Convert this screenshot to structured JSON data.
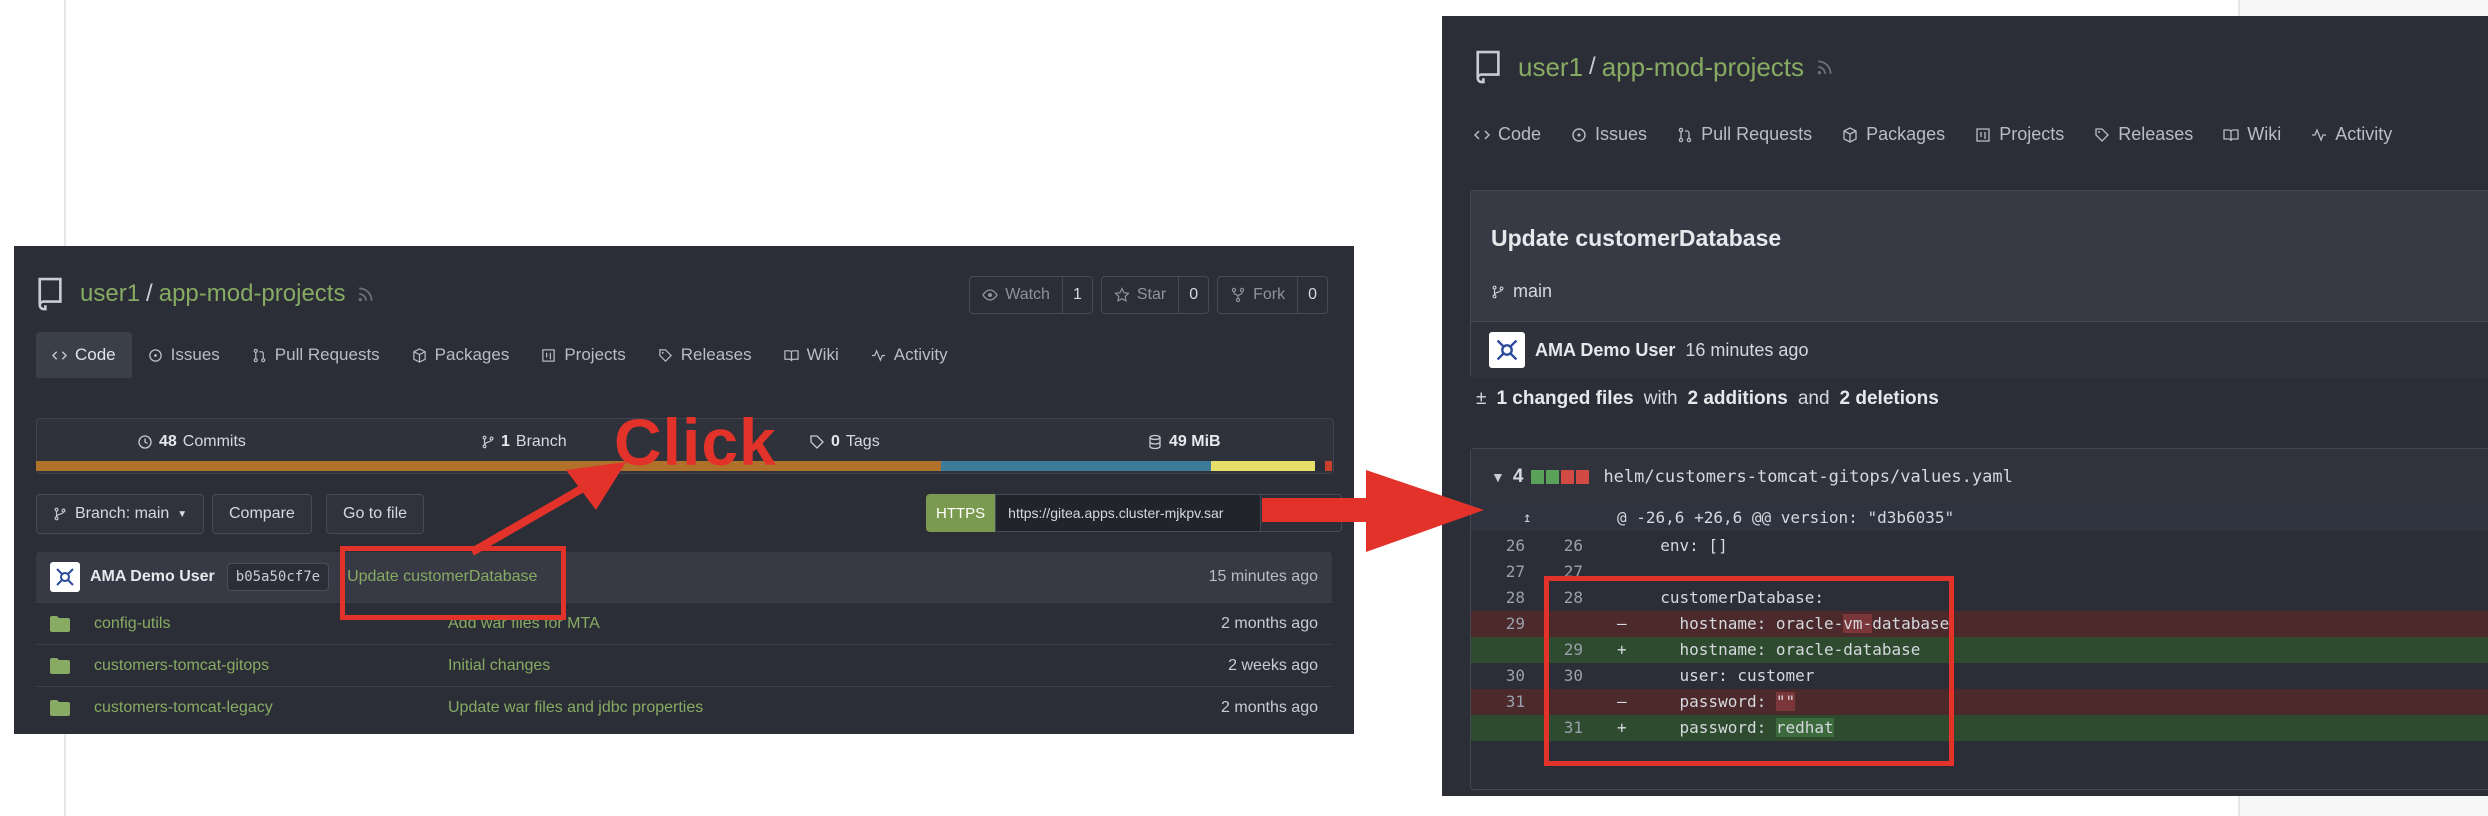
{
  "left": {
    "repo": {
      "owner": "user1",
      "sep": "/",
      "name": "app-mod-projects"
    },
    "actions": [
      {
        "label": "Watch",
        "count": "1",
        "icon": "eye-icon"
      },
      {
        "label": "Star",
        "count": "0",
        "icon": "star-icon"
      },
      {
        "label": "Fork",
        "count": "0",
        "icon": "fork-icon"
      }
    ],
    "tabs": [
      "Code",
      "Issues",
      "Pull Requests",
      "Packages",
      "Projects",
      "Releases",
      "Wiki",
      "Activity"
    ],
    "stats": {
      "commits_num": "48",
      "commits_label": "Commits",
      "branch_num": "1",
      "branch_label": "Branch",
      "tags_num": "0",
      "tags_label": "Tags",
      "size": "49 MiB"
    },
    "lang_colors": [
      "#b0722a",
      "#3d7b9a",
      "#e8de6a",
      "#c8402a"
    ],
    "branch_btn": "Branch: main",
    "compare": "Compare",
    "goto_file": "Go to file",
    "clone_protocol": "HTTPS",
    "clone_url": "https://gitea.apps.cluster-mjkpv.sar",
    "last_commit": {
      "author": "AMA Demo User",
      "sha": "b05a50cf7e",
      "message": "Update customerDatabase",
      "time": "15 minutes ago"
    },
    "files": [
      {
        "name": "config-utils",
        "message": "Add war files for MTA",
        "time": "2 months ago"
      },
      {
        "name": "customers-tomcat-gitops",
        "message": "Initial changes",
        "time": "2 weeks ago"
      },
      {
        "name": "customers-tomcat-legacy",
        "message": "Update war files and jdbc properties",
        "time": "2 months ago"
      }
    ]
  },
  "right": {
    "repo": {
      "owner": "user1",
      "sep": "/",
      "name": "app-mod-projects"
    },
    "tabs": [
      "Code",
      "Issues",
      "Pull Requests",
      "Packages",
      "Projects",
      "Releases",
      "Wiki",
      "Activity"
    ],
    "commit_title": "Update customerDatabase",
    "branch": "main",
    "author": "AMA Demo User",
    "time": "16 minutes ago",
    "summary": {
      "sign": "±",
      "files": "1 changed files",
      "with": "with",
      "additions": "2 additions",
      "and": "and",
      "deletions": "2 deletions"
    },
    "diff": {
      "count": "4",
      "file": "helm/customers-tomcat-gitops/values.yaml",
      "hunk": "@ -26,6 +26,6 @@ version: \"d3b6035\""
    },
    "lines": [
      {
        "old": "26",
        "new": "26",
        "sign": "",
        "pre": "  env: []",
        "hl": "",
        "post": "",
        "type": "ctx"
      },
      {
        "old": "27",
        "new": "27",
        "sign": "",
        "pre": "",
        "hl": "",
        "post": "",
        "type": "ctx"
      },
      {
        "old": "28",
        "new": "28",
        "sign": "",
        "pre": "  customerDatabase:",
        "hl": "",
        "post": "",
        "type": "ctx"
      },
      {
        "old": "29",
        "new": "",
        "sign": "–",
        "pre": "    hostname: oracle-",
        "hl": "vm-",
        "post": "database",
        "type": "del"
      },
      {
        "old": "",
        "new": "29",
        "sign": "+",
        "pre": "    hostname: oracle-database",
        "hl": "",
        "post": "",
        "type": "add"
      },
      {
        "old": "30",
        "new": "30",
        "sign": "",
        "pre": "    user: customer",
        "hl": "",
        "post": "",
        "type": "ctx"
      },
      {
        "old": "31",
        "new": "",
        "sign": "–",
        "pre": "    password: ",
        "hl": "\"\"",
        "post": "",
        "type": "del"
      },
      {
        "old": "",
        "new": "31",
        "sign": "+",
        "pre": "    password: ",
        "hl": "redhat",
        "post": "",
        "type": "add"
      }
    ]
  },
  "annotation": {
    "click_label": "Click",
    "color": "#e2322a"
  }
}
